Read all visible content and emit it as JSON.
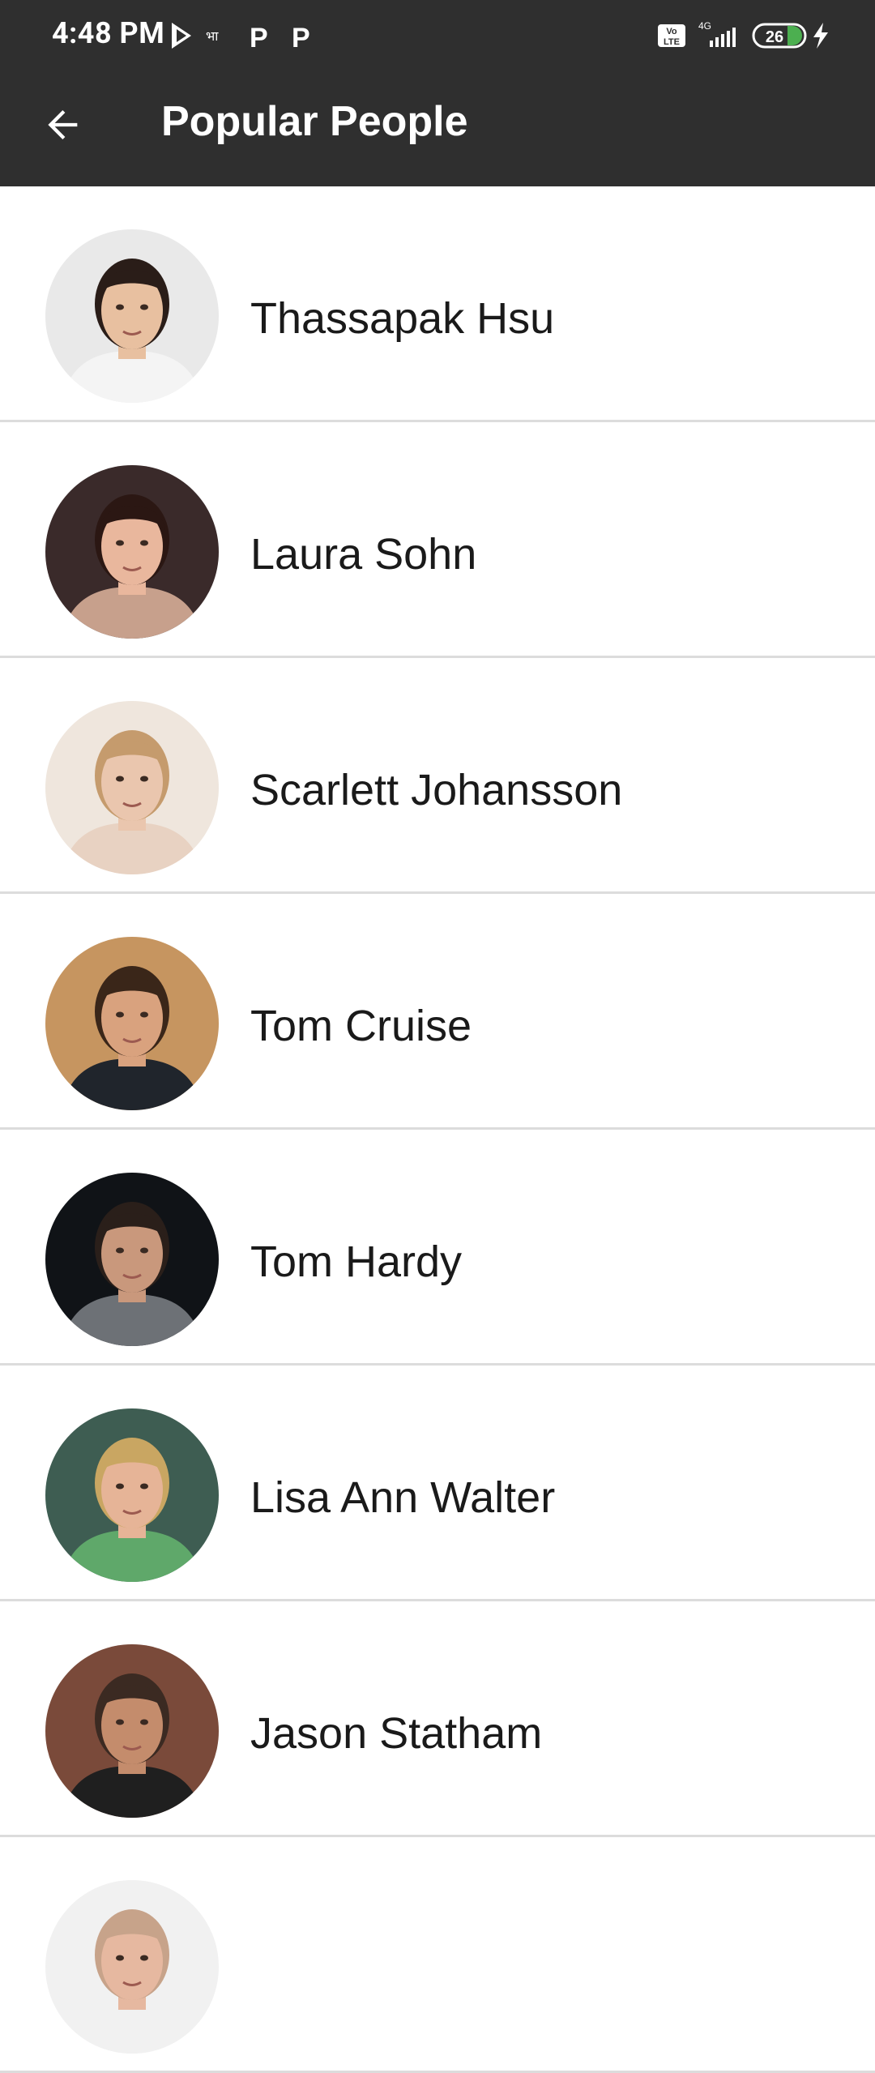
{
  "status_bar": {
    "time": "4:48 PM",
    "battery": "26",
    "network": "4G",
    "volte": "Vo LTE"
  },
  "app_bar": {
    "title": "Popular People",
    "back_icon": "arrow-left-icon"
  },
  "people": [
    {
      "name": "Thassapak Hsu",
      "avatar_bg": "#e9e9e9",
      "skin": "#e8c0a0",
      "hair": "#2a1d18",
      "shirt": "#f4f4f4"
    },
    {
      "name": "Laura Sohn",
      "avatar_bg": "#3a2a2a",
      "skin": "#e9b79d",
      "hair": "#2b1713",
      "shirt": "#c7a08c"
    },
    {
      "name": "Scarlett Johansson",
      "avatar_bg": "#efe6dd",
      "skin": "#eac6ae",
      "hair": "#c59b6d",
      "shirt": "#e8d2c2"
    },
    {
      "name": "Tom Cruise",
      "avatar_bg": "#c69560",
      "skin": "#d9a27e",
      "hair": "#3a2619",
      "shirt": "#20252c"
    },
    {
      "name": "Tom Hardy",
      "avatar_bg": "#101317",
      "skin": "#c9987c",
      "hair": "#2a1f1a",
      "shirt": "#6d7176"
    },
    {
      "name": "Lisa Ann Walter",
      "avatar_bg": "#3e5d52",
      "skin": "#e6b497",
      "hair": "#c9a662",
      "shirt": "#5fa86a"
    },
    {
      "name": "Jason Statham",
      "avatar_bg": "#7a4a3a",
      "skin": "#c48c6c",
      "hair": "#3b2a22",
      "shirt": "#1f1f1f"
    },
    {
      "name": "",
      "avatar_bg": "#f1f1f1",
      "skin": "#e6b8a0",
      "hair": "#c7a38a",
      "shirt": "#f1f1f1"
    }
  ]
}
